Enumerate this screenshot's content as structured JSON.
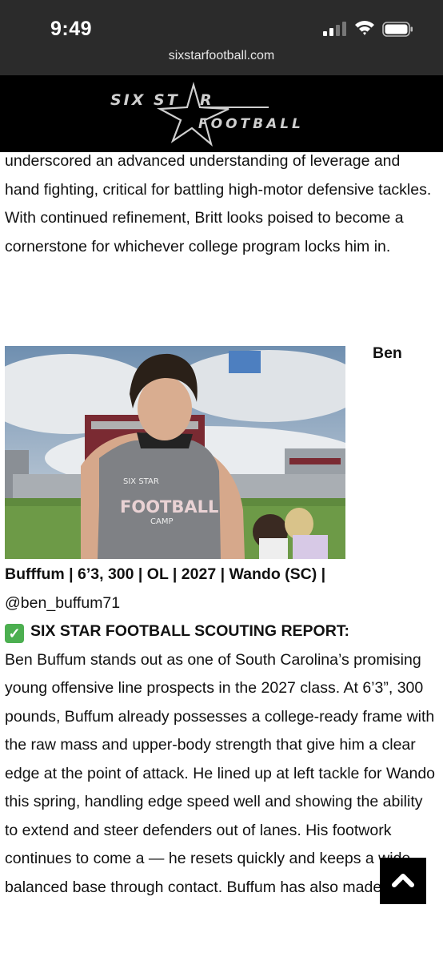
{
  "status_bar": {
    "time": "9:49",
    "url": "sixstarfootball.com"
  },
  "logo": {
    "six": "SIX ST",
    "r": "R",
    "football": "FOOTBALL"
  },
  "article": {
    "intro_text": "underscored an advanced understanding of leverage and hand fighting, critical for battling high-motor defensive tackles. With continued refinement, Britt looks poised to become a cornerstone for whichever college program locks him in.",
    "player_first": "Ben",
    "player_line": "Bufffum | 6’3, 300 | OL | 2027 | Wando (SC) |",
    "handle": "@ben_buffum71",
    "report_heading": "SIX STAR FOOTBALL SCOUTING REPORT:",
    "report_text": "Ben Buffum stands out as one of South Carolina’s promising young offensive line prospects in the 2027 class. At 6’3”, 300 pounds, Buffum already possesses a college-ready frame with the raw mass and upper-body strength that give him a clear edge at the point of attack. He lined up at left tackle for Wando this spring, handling edge speed well and showing the ability to extend and steer defenders out of lanes. His footwork continues to come a — he resets quickly and keeps a wide, balanced base through contact. Buffum has also made the"
  },
  "photo": {
    "shirt_text_1": "SIX STAR",
    "shirt_text_2": "FOOTBALL",
    "shirt_text_3": "CAMP"
  },
  "colors": {
    "status_bg": "#2b2b2b",
    "header_bg": "#000000",
    "check": "#4caf50"
  },
  "icons": {
    "signal": "cellular-signal-icon",
    "wifi": "wifi-icon",
    "battery": "battery-icon",
    "check": "check-mark-icon",
    "scroll_top": "chevron-up-icon"
  }
}
